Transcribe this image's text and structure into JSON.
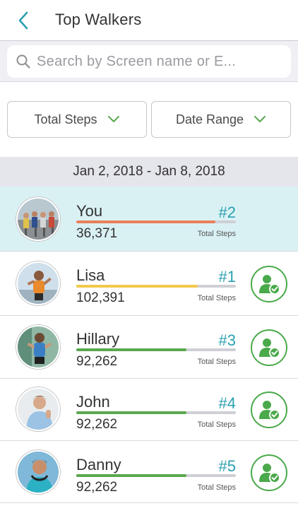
{
  "header": {
    "title": "Top Walkers",
    "back_icon": "chevron-left-icon"
  },
  "search": {
    "placeholder": "Search by Screen name or E...",
    "value": ""
  },
  "filters": {
    "sort": {
      "label": "Total Steps",
      "icon": "chevron-down-icon"
    },
    "range": {
      "label": "Date Range",
      "icon": "chevron-down-icon"
    }
  },
  "date_range": "Jan 2, 2018 - Jan 8, 2018",
  "colors": {
    "accent": "#2a9fb0",
    "green": "#4aa94a",
    "orange": "#e8805a",
    "yellow": "#f2c94c",
    "highlight_row": "#daf1f4"
  },
  "walkers": [
    {
      "name": "You",
      "rank": "#2",
      "steps": "36,371",
      "steps_label": "Total Steps",
      "progress": 0.87,
      "bar_color": "#e8805a",
      "is_me": true,
      "avatar": "runners-crowd-photo"
    },
    {
      "name": "Lisa",
      "rank": "#1",
      "steps": "102,391",
      "steps_label": "Total Steps",
      "progress": 0.76,
      "bar_color": "#f2c94c",
      "is_me": false,
      "avatar": "woman-runner-photo"
    },
    {
      "name": "Hillary",
      "rank": "#3",
      "steps": "92,262",
      "steps_label": "Total Steps",
      "progress": 0.69,
      "bar_color": "#5aa84e",
      "is_me": false,
      "avatar": "woman-jogger-photo"
    },
    {
      "name": "John",
      "rank": "#4",
      "steps": "92,262",
      "steps_label": "Total Steps",
      "progress": 0.69,
      "bar_color": "#5aa84e",
      "is_me": false,
      "avatar": "man-thumbs-up-photo"
    },
    {
      "name": "Danny",
      "rank": "#5",
      "steps": "92,262",
      "steps_label": "Total Steps",
      "progress": 0.69,
      "bar_color": "#5aa84e",
      "is_me": false,
      "avatar": "man-headphones-photo"
    }
  ]
}
